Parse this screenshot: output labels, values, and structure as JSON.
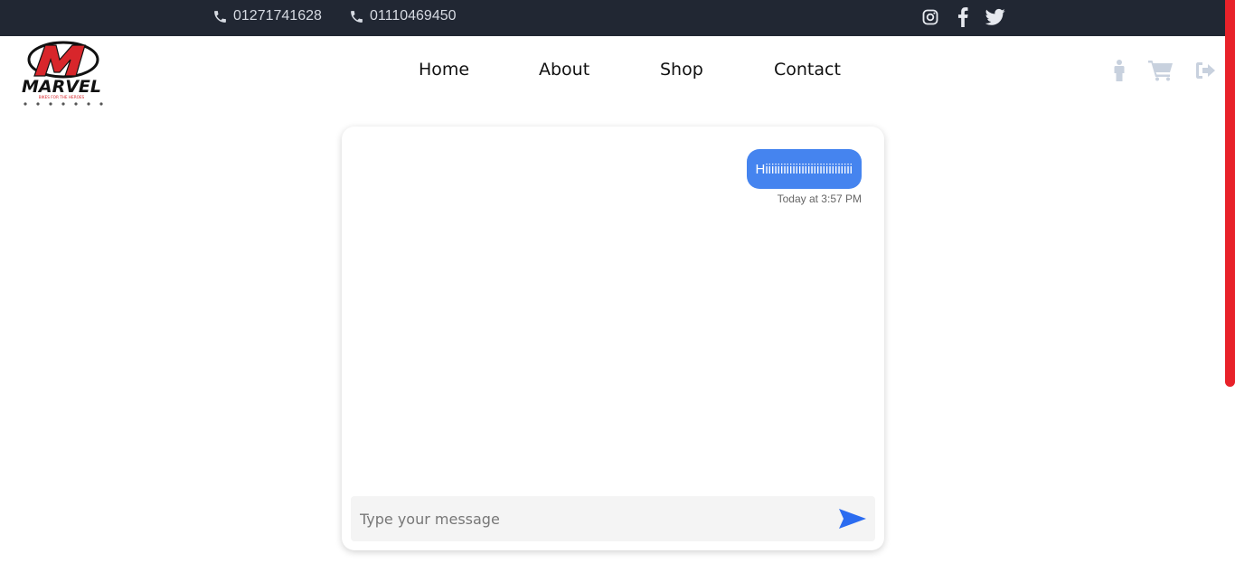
{
  "topbar": {
    "phones": [
      "01271741628",
      "01110469450"
    ],
    "social_icons": [
      "instagram-icon",
      "facebook-icon",
      "twitter-icon"
    ]
  },
  "brand": {
    "logo_text": "MARVEL",
    "logo_letter": "M",
    "tagline": "BIKES FOR THE HEROES"
  },
  "nav": {
    "links": [
      "Home",
      "About",
      "Shop",
      "Contact"
    ],
    "icons": [
      "user-icon",
      "cart-icon",
      "logout-icon"
    ]
  },
  "chat": {
    "messages": [
      {
        "text": "Hiiiiiiiiiiiiiiiiiiiiiiiiiiiii",
        "time": "Today at 3:57 PM",
        "from": "me"
      }
    ],
    "input_placeholder": "Type your message",
    "send_icon": "send-icon"
  },
  "colors": {
    "topbar_bg": "#212733",
    "bubble_bg": "#4584ef",
    "accent_red": "#e8222a",
    "send_blue": "#2b6cf0",
    "nav_icon": "#c8d1de"
  }
}
